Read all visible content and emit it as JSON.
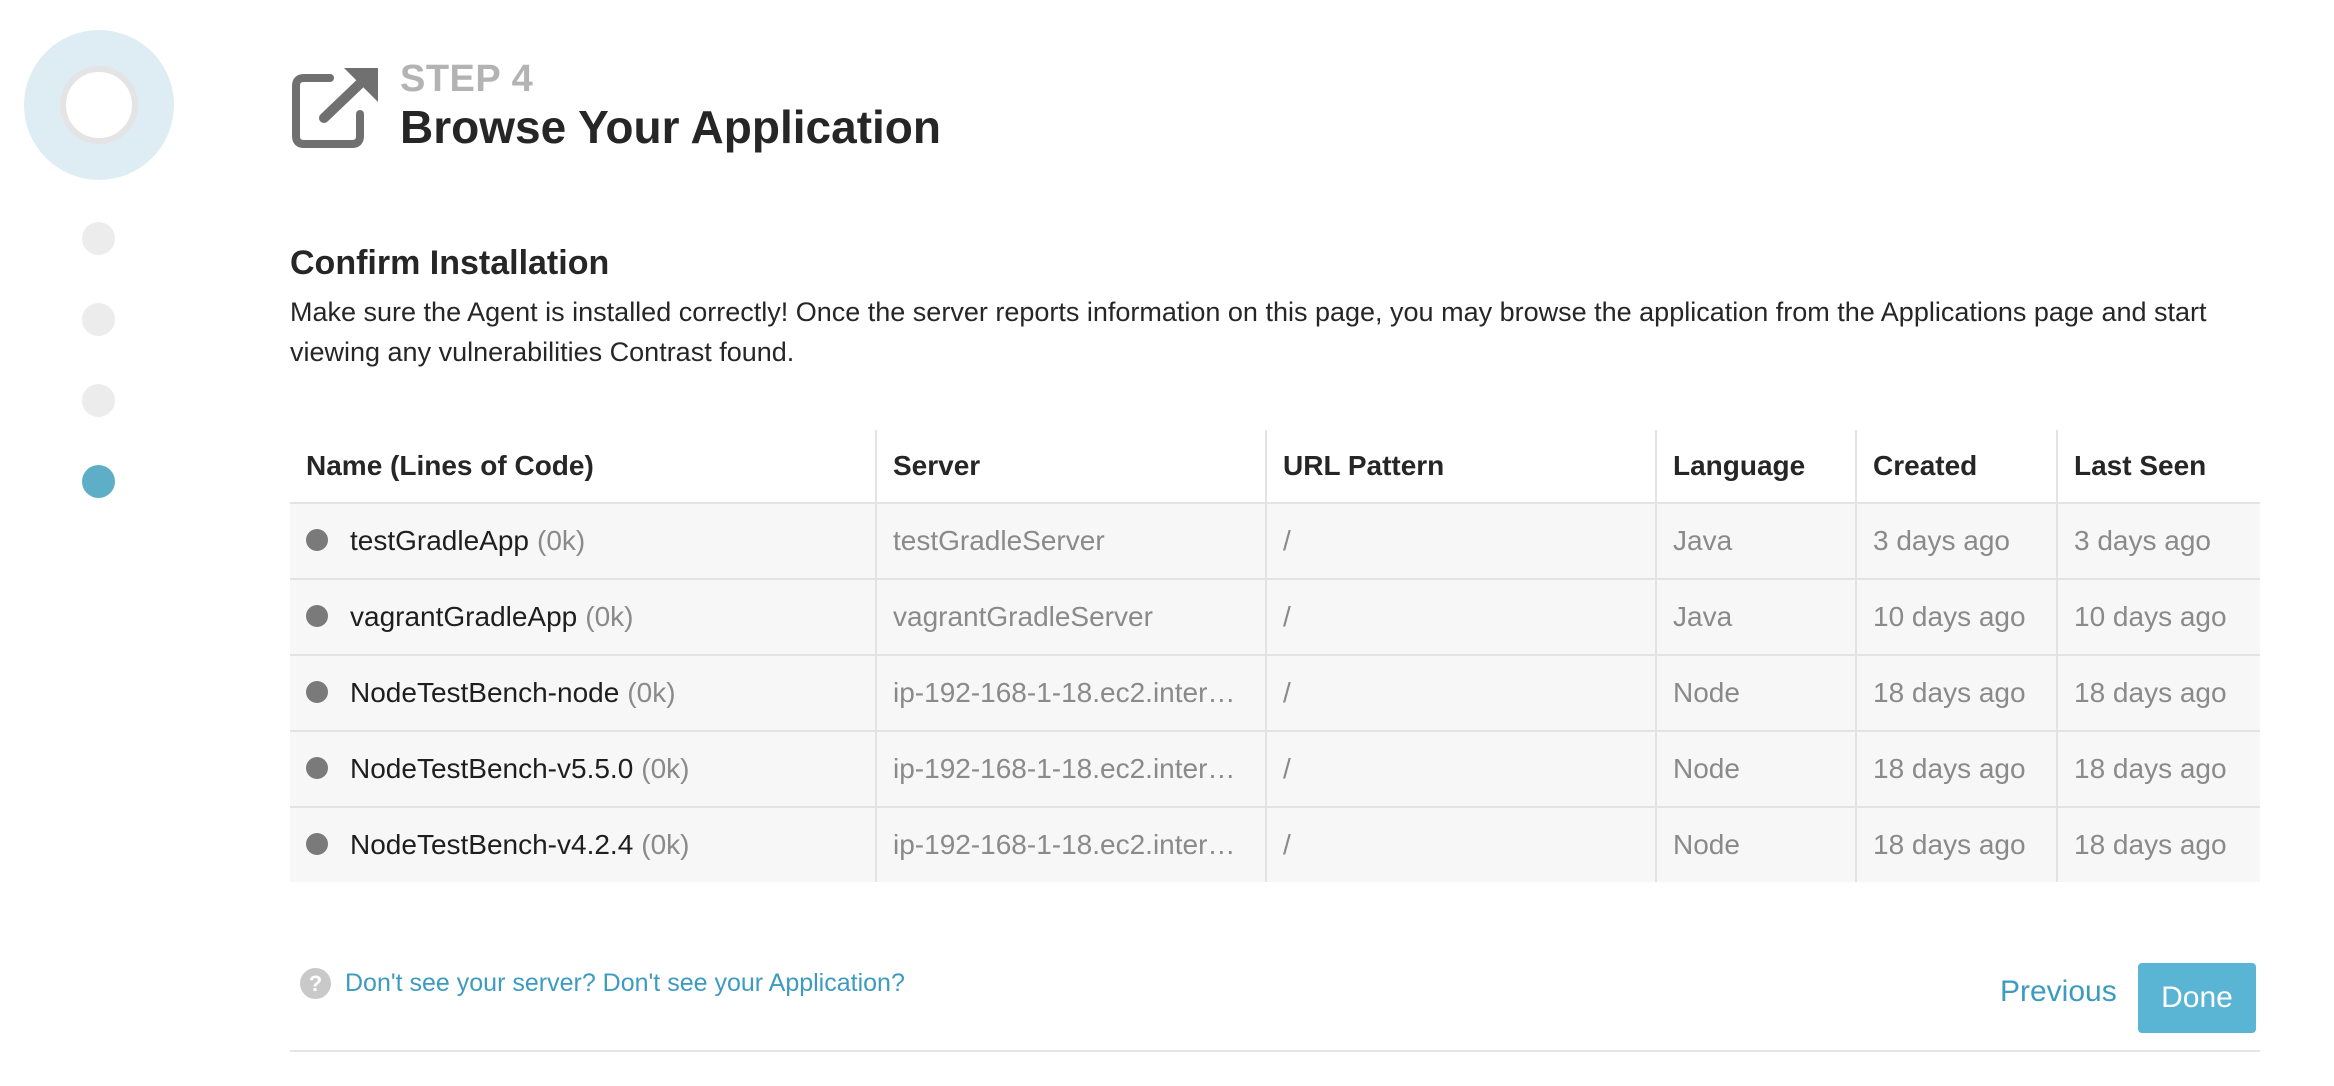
{
  "step": {
    "label": "STEP 4",
    "title": "Browse Your Application"
  },
  "section": {
    "title": "Confirm Installation",
    "description": "Make sure the Agent is installed correctly! Once the server reports information on this page, you may browse the application from the Applications page and start viewing any vulnerabilities Contrast found."
  },
  "table": {
    "headers": [
      "Name (Lines of Code)",
      "Server",
      "URL Pattern",
      "Language",
      "Created",
      "Last Seen"
    ],
    "rows": [
      {
        "name": "testGradleApp",
        "loc": "(0k)",
        "server": "testGradleServer",
        "url": "/",
        "language": "Java",
        "created": "3 days ago",
        "last_seen": "3 days ago"
      },
      {
        "name": "vagrantGradleApp",
        "loc": "(0k)",
        "server": "vagrantGradleServer",
        "url": "/",
        "language": "Java",
        "created": "10 days ago",
        "last_seen": "10 days ago"
      },
      {
        "name": "NodeTestBench-node",
        "loc": "(0k)",
        "server": "ip-192-168-1-18.ec2.intern…",
        "url": "/",
        "language": "Node",
        "created": "18 days ago",
        "last_seen": "18 days ago"
      },
      {
        "name": "NodeTestBench-v5.5.0",
        "loc": "(0k)",
        "server": "ip-192-168-1-18.ec2.intern…",
        "url": "/",
        "language": "Node",
        "created": "18 days ago",
        "last_seen": "18 days ago"
      },
      {
        "name": "NodeTestBench-v4.2.4",
        "loc": "(0k)",
        "server": "ip-192-168-1-18.ec2.intern…",
        "url": "/",
        "language": "Node",
        "created": "18 days ago",
        "last_seen": "18 days ago"
      }
    ]
  },
  "footer": {
    "help_icon": "question-circle-icon",
    "help_text": "Don't see your server? Don't see your Application?",
    "previous_label": "Previous",
    "done_label": "Done"
  },
  "colors": {
    "accent": "#5ab5d4",
    "link": "#3c9bbf",
    "active_step": "#5eaec8"
  }
}
